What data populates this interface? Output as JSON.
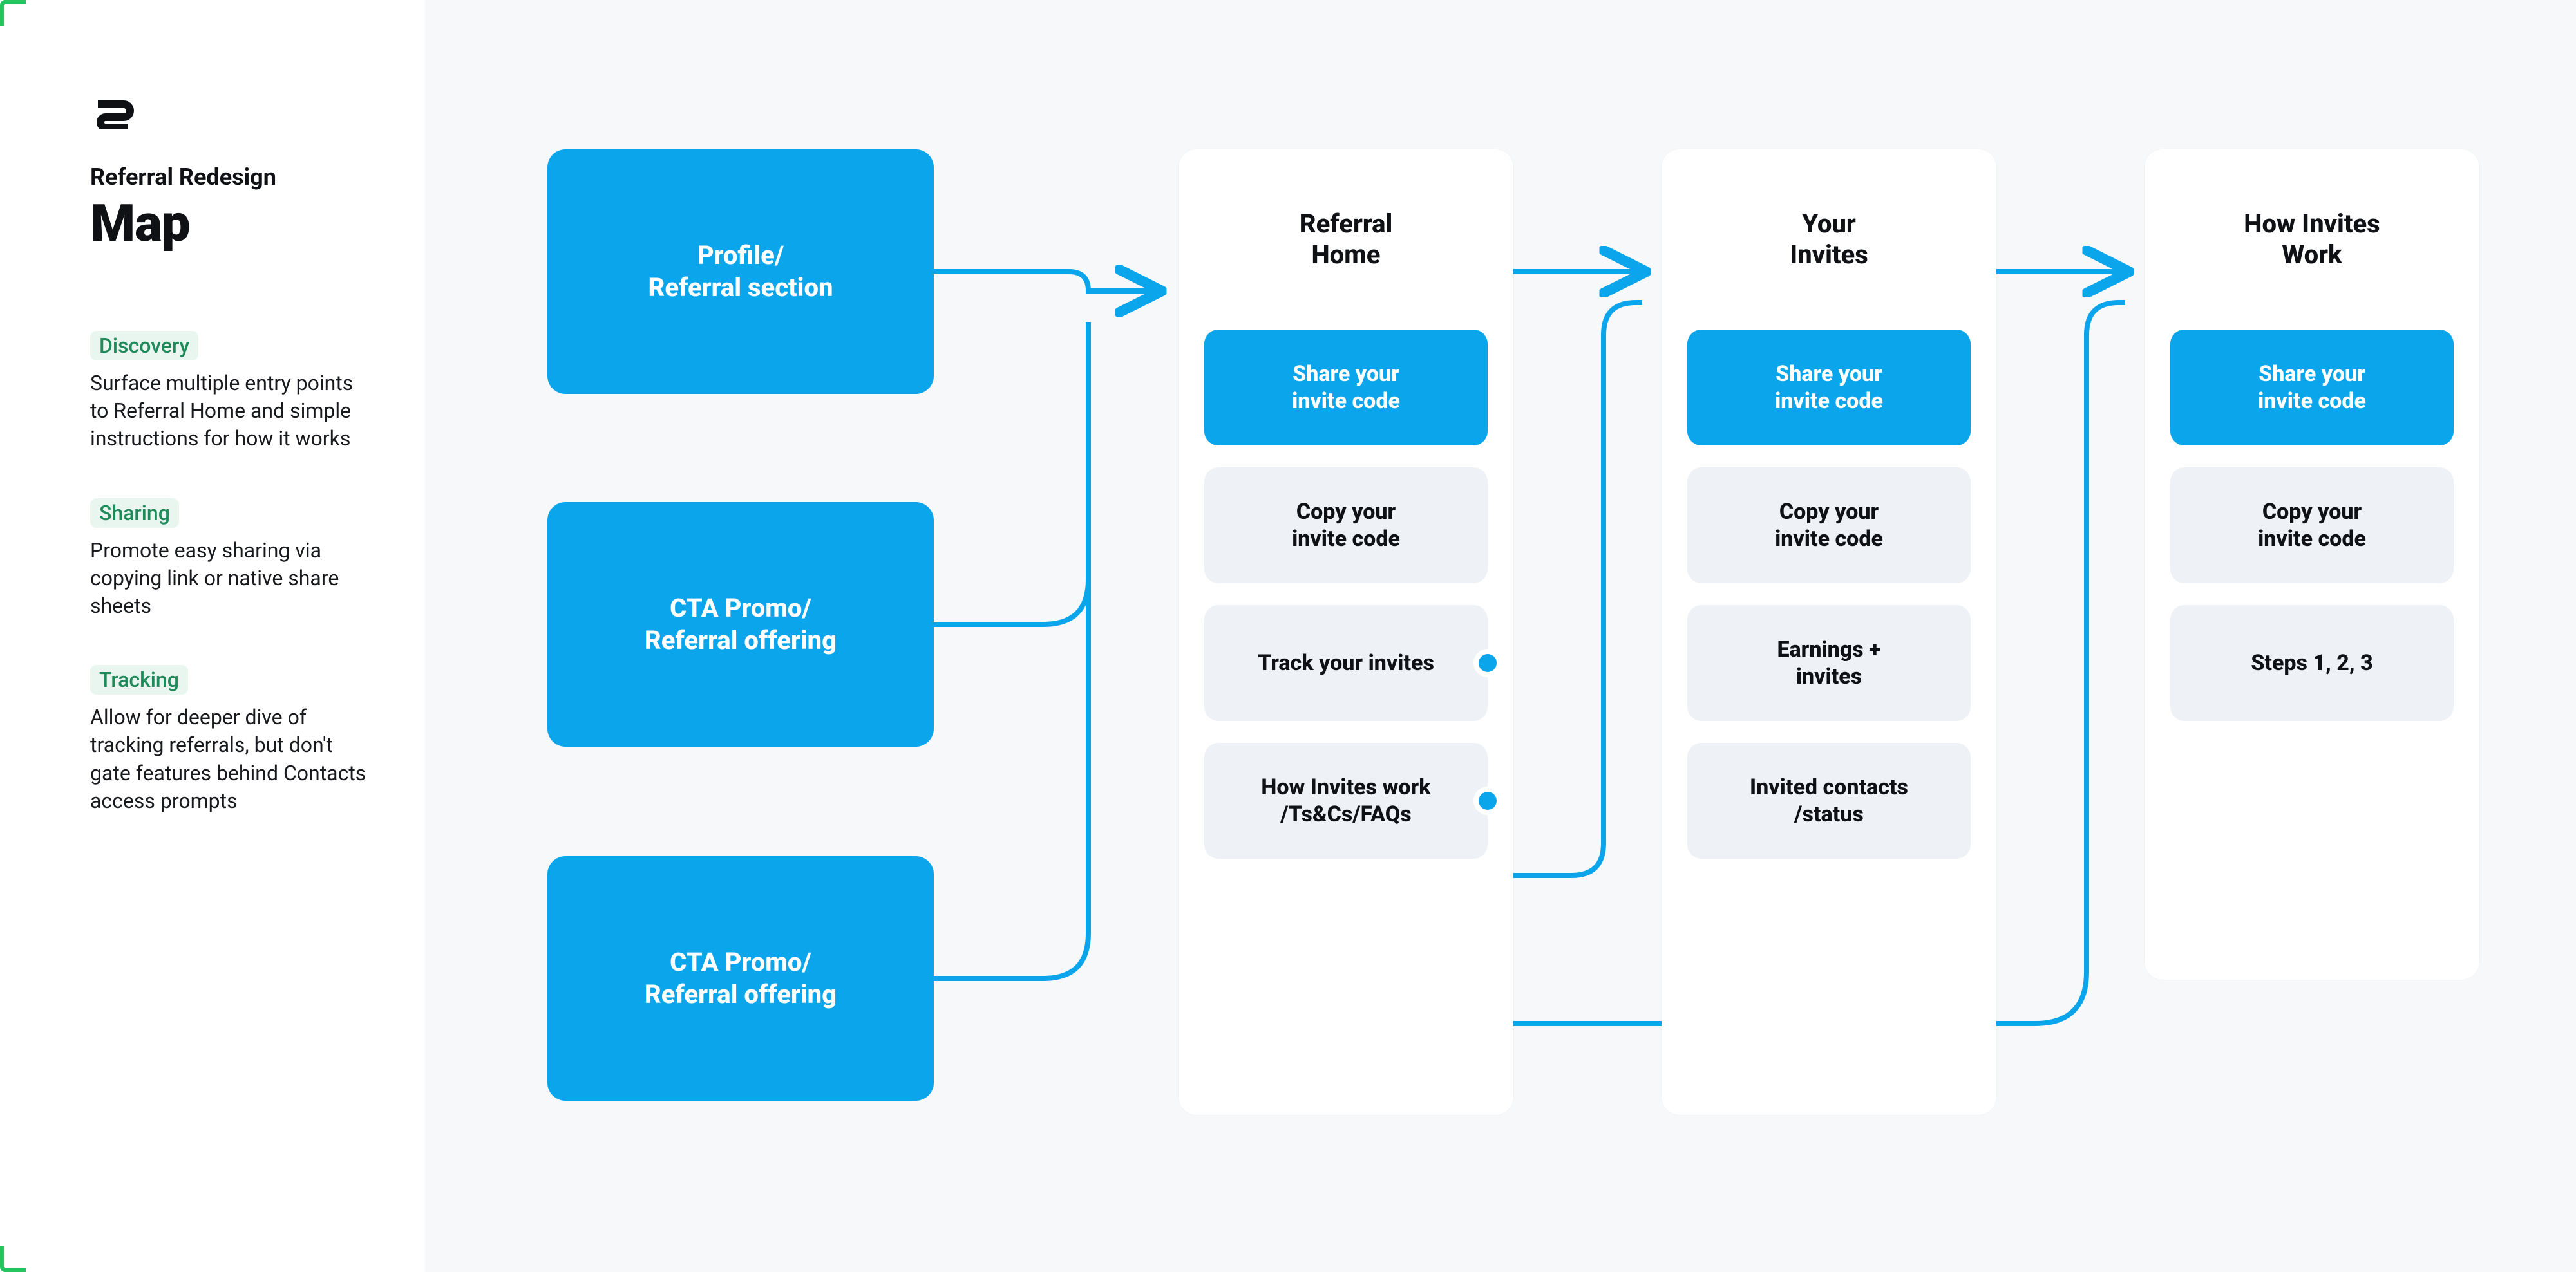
{
  "header": {
    "subtitle": "Referral Redesign",
    "title": "Map"
  },
  "sidebar": {
    "sections": [
      {
        "label": "Discovery",
        "body": "Surface multiple entry points to Referral Home and simple instructions for how it works"
      },
      {
        "label": "Sharing",
        "body": "Promote easy sharing via copying link or native share sheets"
      },
      {
        "label": "Tracking",
        "body": "Allow for deeper dive of tracking referrals, but don't gate features behind Contacts access prompts"
      }
    ]
  },
  "diagram": {
    "entries": [
      {
        "label": "Profile/\nReferral section"
      },
      {
        "label": "CTA Promo/\nReferral offering"
      },
      {
        "label": "CTA Promo/\nReferral offering"
      }
    ],
    "screens": [
      {
        "title": "Referral\nHome",
        "tiles": [
          {
            "label": "Share your\ninvite code",
            "kind": "primary"
          },
          {
            "label": "Copy your\ninvite code",
            "kind": "muted"
          },
          {
            "label": "Track your invites",
            "kind": "muted",
            "connector": true
          },
          {
            "label": "How Invites work\n/Ts&Cs/FAQs",
            "kind": "muted",
            "connector": true
          }
        ]
      },
      {
        "title": "Your\nInvites",
        "tiles": [
          {
            "label": "Share your\ninvite code",
            "kind": "primary"
          },
          {
            "label": "Copy your\ninvite code",
            "kind": "muted"
          },
          {
            "label": "Earnings +\ninvites",
            "kind": "muted"
          },
          {
            "label": "Invited contacts\n/status",
            "kind": "muted"
          }
        ]
      },
      {
        "title": "How Invites\nWork",
        "tiles": [
          {
            "label": "Share your\ninvite code",
            "kind": "primary"
          },
          {
            "label": "Copy your\ninvite code",
            "kind": "muted"
          },
          {
            "label": "Steps 1, 2, 3",
            "kind": "muted"
          }
        ]
      }
    ]
  },
  "colors": {
    "accent": "#0ba5ec",
    "pill_bg": "#e8f6ef",
    "pill_fg": "#1f8a5a",
    "muted_tile": "#eef1f5",
    "page_bg": "#f6f8fa"
  }
}
